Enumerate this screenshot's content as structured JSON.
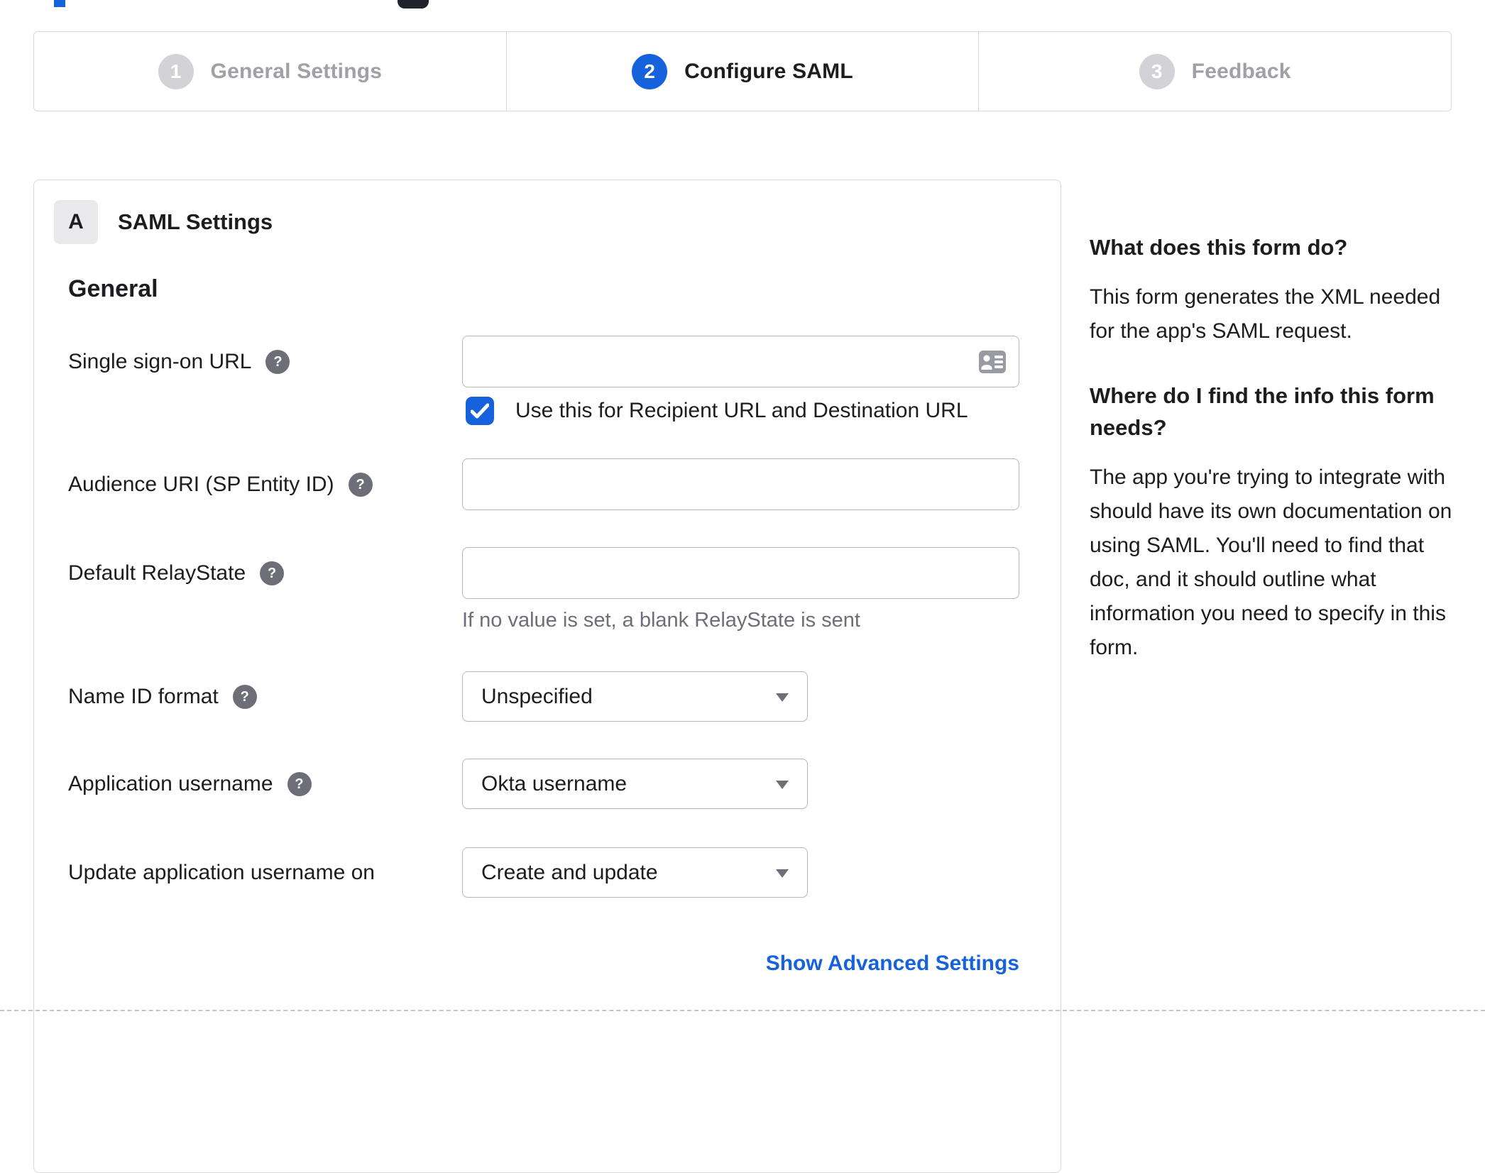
{
  "stepper": {
    "steps": [
      {
        "number": "1",
        "label": "General Settings",
        "state": "inactive"
      },
      {
        "number": "2",
        "label": "Configure SAML",
        "state": "active"
      },
      {
        "number": "3",
        "label": "Feedback",
        "state": "inactive"
      }
    ]
  },
  "panel": {
    "section_badge": "A",
    "section_title": "SAML Settings",
    "group_title": "General",
    "fields": {
      "sso_url": {
        "label": "Single sign-on URL",
        "value": "",
        "placeholder": "",
        "checkbox_label": "Use this for Recipient URL and Destination URL",
        "checkbox_checked": true
      },
      "audience_uri": {
        "label": "Audience URI (SP Entity ID)",
        "value": "",
        "placeholder": ""
      },
      "relay_state": {
        "label": "Default RelayState",
        "value": "",
        "placeholder": "",
        "hint": "If no value is set, a blank RelayState is sent"
      },
      "name_id_format": {
        "label": "Name ID format",
        "value": "Unspecified"
      },
      "app_username": {
        "label": "Application username",
        "value": "Okta username"
      },
      "update_app_username": {
        "label": "Update application username on",
        "value": "Create and update"
      }
    },
    "advanced_link": "Show Advanced Settings"
  },
  "sidebar": {
    "sections": [
      {
        "heading": "What does this form do?",
        "body": "This form generates the XML needed for the app's SAML request."
      },
      {
        "heading": "Where do I find the info this form needs?",
        "body": "The app you're trying to integrate with should have its own documentation on using SAML. You'll need to find that doc, and it should outline what information you need to specify in this form."
      }
    ]
  },
  "icons": {
    "help_glyph": "?"
  },
  "colors": {
    "accent": "#1662dd",
    "inactive_badge": "#d2d2d7",
    "help_icon_bg": "#6e6e78",
    "border": "#d8d8dc",
    "input_border": "#b6b6bd",
    "hint_text": "#6e6e78"
  }
}
